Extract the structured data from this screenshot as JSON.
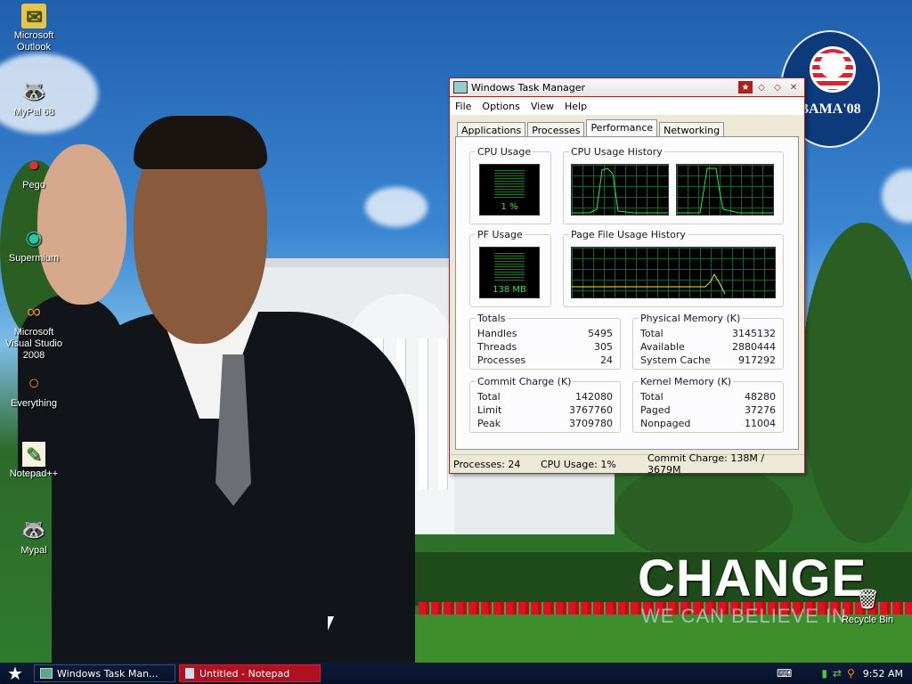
{
  "desktop": {
    "icons": [
      {
        "label": "Microsoft Outlook",
        "icon": "outlook-icon",
        "glyph": "✉"
      },
      {
        "label": "MyPal 68",
        "icon": "mypal-icon",
        "glyph": "🦝"
      },
      {
        "label": "Pego",
        "icon": "pego-icon",
        "glyph": "●"
      },
      {
        "label": "Supermium",
        "icon": "supermium-icon",
        "glyph": "◉"
      },
      {
        "label": "Microsoft Visual Studio 2008",
        "icon": "visual-studio-icon",
        "glyph": "∞"
      },
      {
        "label": "Everything",
        "icon": "everything-icon",
        "glyph": "○"
      },
      {
        "label": "Notepad++",
        "icon": "notepadpp-icon",
        "glyph": "✎"
      },
      {
        "label": "Mypal",
        "icon": "mypal-icon",
        "glyph": "🦝"
      }
    ],
    "recycle_bin": {
      "label": "Recycle Bin",
      "glyph": "🗑"
    },
    "wallpaper": {
      "logo_text": "BAMA'08",
      "headline": "CHANGE",
      "slogan": "WE CAN BELIEVE IN"
    }
  },
  "task_manager": {
    "title": "Windows Task Manager",
    "menu": [
      "File",
      "Options",
      "View",
      "Help"
    ],
    "tabs": [
      "Applications",
      "Processes",
      "Performance",
      "Networking"
    ],
    "active_tab": "Performance",
    "cpu_usage": {
      "label": "CPU Usage",
      "value": "1 %"
    },
    "cpu_history": {
      "label": "CPU Usage History"
    },
    "pf_usage": {
      "label": "PF Usage",
      "value": "138 MB"
    },
    "pf_history": {
      "label": "Page File Usage History"
    },
    "totals": {
      "label": "Totals",
      "rows": [
        {
          "k": "Handles",
          "v": "5495"
        },
        {
          "k": "Threads",
          "v": "305"
        },
        {
          "k": "Processes",
          "v": "24"
        }
      ]
    },
    "physical_memory": {
      "label": "Physical Memory (K)",
      "rows": [
        {
          "k": "Total",
          "v": "3145132"
        },
        {
          "k": "Available",
          "v": "2880444"
        },
        {
          "k": "System Cache",
          "v": "917292"
        }
      ]
    },
    "commit_charge": {
      "label": "Commit Charge (K)",
      "rows": [
        {
          "k": "Total",
          "v": "142080"
        },
        {
          "k": "Limit",
          "v": "3767760"
        },
        {
          "k": "Peak",
          "v": "3709780"
        }
      ]
    },
    "kernel_memory": {
      "label": "Kernel Memory (K)",
      "rows": [
        {
          "k": "Total",
          "v": "48280"
        },
        {
          "k": "Paged",
          "v": "37276"
        },
        {
          "k": "Nonpaged",
          "v": "11004"
        }
      ]
    },
    "status": {
      "processes": "Processes: 24",
      "cpu": "CPU Usage: 1%",
      "commit": "Commit Charge: 138M / 3679M"
    }
  },
  "taskbar": {
    "tasks": [
      {
        "label": "Windows Task Man...",
        "active": false
      },
      {
        "label": "Untitled - Notepad",
        "active": true
      }
    ],
    "clock": "9:52 AM"
  }
}
